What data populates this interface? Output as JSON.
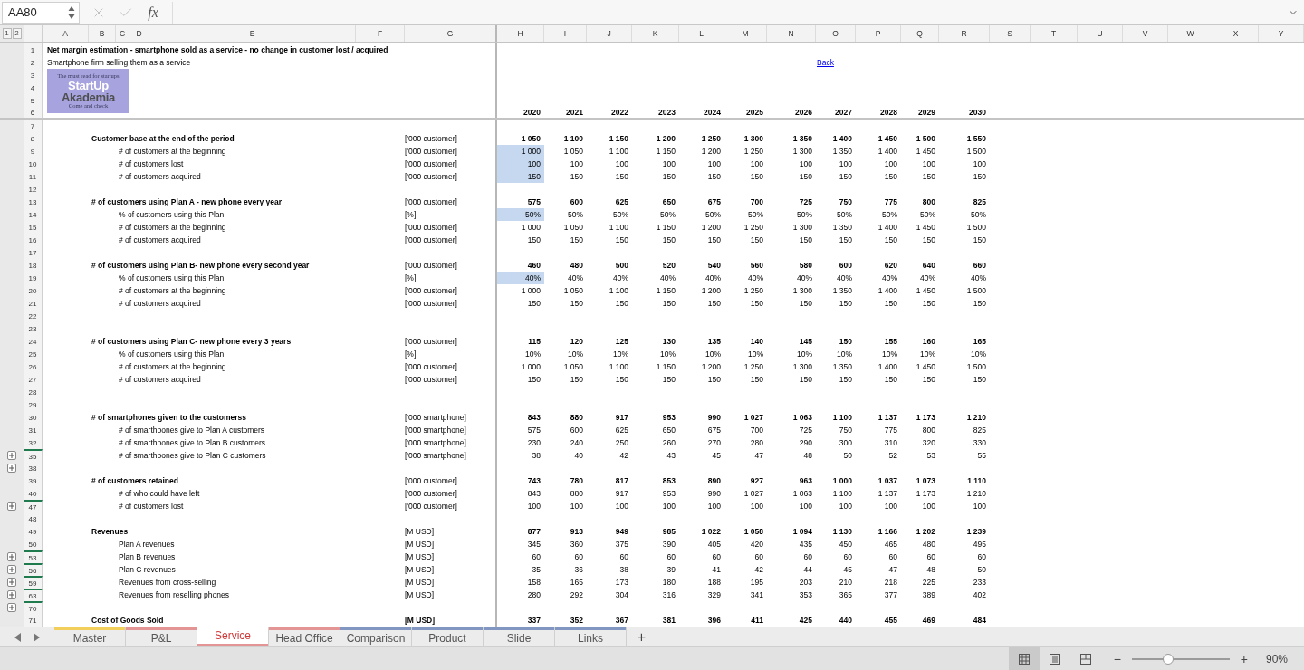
{
  "formula_bar": {
    "name_box": "AA80",
    "fx": "fx"
  },
  "outline_levels": [
    "1",
    "2"
  ],
  "columns": [
    "A",
    "B",
    "C",
    "D",
    "E",
    "F",
    "G",
    "H",
    "I",
    "J",
    "K",
    "L",
    "M",
    "N",
    "O",
    "P",
    "Q",
    "R",
    "S",
    "T",
    "U",
    "V",
    "W",
    "X",
    "Y"
  ],
  "logo": {
    "tagline": "The must read for startups",
    "line1": "StartUp",
    "line2": "Akademia",
    "footer": "Come and check"
  },
  "rows": [
    {
      "number": "1",
      "kind": "title",
      "label": "Net margin estimation - smartphone sold as a service - no change in customer lost / acquired",
      "collapsed": false,
      "hidden_above": false
    },
    {
      "number": "2",
      "kind": "subtitle",
      "label": "Smartphone firm selling them as a service",
      "link": "Back",
      "collapsed": false,
      "hidden_above": false
    },
    {
      "number": "3",
      "kind": "blank",
      "collapsed": false,
      "hidden_above": false
    },
    {
      "number": "4",
      "kind": "blank",
      "collapsed": false,
      "hidden_above": false
    },
    {
      "number": "5",
      "kind": "blank",
      "collapsed": false,
      "hidden_above": false
    },
    {
      "number": "6",
      "kind": "years",
      "values": [
        "2020",
        "2021",
        "2022",
        "2023",
        "2024",
        "2025",
        "2026",
        "2027",
        "2028",
        "2029",
        "2030"
      ],
      "highlight": false,
      "collapsed": false,
      "hidden_above": false
    },
    {
      "number": "7",
      "kind": "blank",
      "collapsed": false,
      "hidden_above": false
    },
    {
      "number": "8",
      "kind": "header",
      "label": "Customer base at the end  of the period",
      "unit": "['000 customer]",
      "values": [
        "1 050",
        "1 100",
        "1 150",
        "1 200",
        "1 250",
        "1 300",
        "1 350",
        "1 400",
        "1 450",
        "1 500",
        "1 550"
      ],
      "highlight": false,
      "collapsed": false,
      "hidden_above": false
    },
    {
      "number": "9",
      "kind": "item",
      "label": "# of customers at the beginning",
      "unit": "['000 customer]",
      "values": [
        "1 000",
        "1 050",
        "1 100",
        "1 150",
        "1 200",
        "1 250",
        "1 300",
        "1 350",
        "1 400",
        "1 450",
        "1 500"
      ],
      "highlight": true,
      "collapsed": false,
      "hidden_above": false
    },
    {
      "number": "10",
      "kind": "item",
      "label": "# of customers lost",
      "unit": "['000 customer]",
      "values": [
        "100",
        "100",
        "100",
        "100",
        "100",
        "100",
        "100",
        "100",
        "100",
        "100",
        "100"
      ],
      "highlight": true,
      "collapsed": false,
      "hidden_above": false
    },
    {
      "number": "11",
      "kind": "item",
      "label": "# of customers acquired",
      "unit": "['000 customer]",
      "values": [
        "150",
        "150",
        "150",
        "150",
        "150",
        "150",
        "150",
        "150",
        "150",
        "150",
        "150"
      ],
      "highlight": true,
      "collapsed": false,
      "hidden_above": false
    },
    {
      "number": "12",
      "kind": "blank",
      "collapsed": false,
      "hidden_above": false
    },
    {
      "number": "13",
      "kind": "header",
      "label": "# of customers using Plan A - new phone every year",
      "unit": "['000 customer]",
      "values": [
        "575",
        "600",
        "625",
        "650",
        "675",
        "700",
        "725",
        "750",
        "775",
        "800",
        "825"
      ],
      "highlight": false,
      "collapsed": false,
      "hidden_above": false
    },
    {
      "number": "14",
      "kind": "item",
      "label": "% of customers using this Plan",
      "unit": "[%]",
      "values": [
        "50%",
        "50%",
        "50%",
        "50%",
        "50%",
        "50%",
        "50%",
        "50%",
        "50%",
        "50%",
        "50%"
      ],
      "highlight": true,
      "collapsed": false,
      "hidden_above": false
    },
    {
      "number": "15",
      "kind": "item",
      "label": "# of customers at the beginning",
      "unit": "['000 customer]",
      "values": [
        "1 000",
        "1 050",
        "1 100",
        "1 150",
        "1 200",
        "1 250",
        "1 300",
        "1 350",
        "1 400",
        "1 450",
        "1 500"
      ],
      "highlight": false,
      "collapsed": false,
      "hidden_above": false
    },
    {
      "number": "16",
      "kind": "item",
      "label": "# of customers acquired",
      "unit": "['000 customer]",
      "values": [
        "150",
        "150",
        "150",
        "150",
        "150",
        "150",
        "150",
        "150",
        "150",
        "150",
        "150"
      ],
      "highlight": false,
      "collapsed": false,
      "hidden_above": false
    },
    {
      "number": "17",
      "kind": "blank",
      "collapsed": false,
      "hidden_above": false
    },
    {
      "number": "18",
      "kind": "header",
      "label": "# of customers using Plan B- new phone every second year",
      "unit": "['000 customer]",
      "values": [
        "460",
        "480",
        "500",
        "520",
        "540",
        "560",
        "580",
        "600",
        "620",
        "640",
        "660"
      ],
      "highlight": false,
      "collapsed": false,
      "hidden_above": false
    },
    {
      "number": "19",
      "kind": "item",
      "label": "% of customers using this Plan",
      "unit": "[%]",
      "values": [
        "40%",
        "40%",
        "40%",
        "40%",
        "40%",
        "40%",
        "40%",
        "40%",
        "40%",
        "40%",
        "40%"
      ],
      "highlight": true,
      "collapsed": false,
      "hidden_above": false
    },
    {
      "number": "20",
      "kind": "item",
      "label": "# of customers at the beginning",
      "unit": "['000 customer]",
      "values": [
        "1 000",
        "1 050",
        "1 100",
        "1 150",
        "1 200",
        "1 250",
        "1 300",
        "1 350",
        "1 400",
        "1 450",
        "1 500"
      ],
      "highlight": false,
      "collapsed": false,
      "hidden_above": false
    },
    {
      "number": "21",
      "kind": "item",
      "label": "# of customers acquired",
      "unit": "['000 customer]",
      "values": [
        "150",
        "150",
        "150",
        "150",
        "150",
        "150",
        "150",
        "150",
        "150",
        "150",
        "150"
      ],
      "highlight": false,
      "collapsed": false,
      "hidden_above": false
    },
    {
      "number": "22",
      "kind": "blank",
      "collapsed": false,
      "hidden_above": false
    },
    {
      "number": "23",
      "kind": "blank",
      "collapsed": false,
      "hidden_above": false
    },
    {
      "number": "24",
      "kind": "header",
      "label": "# of customers using Plan C- new phone every 3 years",
      "unit": "['000 customer]",
      "values": [
        "115",
        "120",
        "125",
        "130",
        "135",
        "140",
        "145",
        "150",
        "155",
        "160",
        "165"
      ],
      "highlight": false,
      "collapsed": false,
      "hidden_above": false
    },
    {
      "number": "25",
      "kind": "item",
      "label": "% of customers using this Plan",
      "unit": "[%]",
      "values": [
        "10%",
        "10%",
        "10%",
        "10%",
        "10%",
        "10%",
        "10%",
        "10%",
        "10%",
        "10%",
        "10%"
      ],
      "highlight": false,
      "collapsed": false,
      "hidden_above": false
    },
    {
      "number": "26",
      "kind": "item",
      "label": "# of customers at the beginning",
      "unit": "['000 customer]",
      "values": [
        "1 000",
        "1 050",
        "1 100",
        "1 150",
        "1 200",
        "1 250",
        "1 300",
        "1 350",
        "1 400",
        "1 450",
        "1 500"
      ],
      "highlight": false,
      "collapsed": false,
      "hidden_above": false
    },
    {
      "number": "27",
      "kind": "item",
      "label": "# of customers acquired",
      "unit": "['000 customer]",
      "values": [
        "150",
        "150",
        "150",
        "150",
        "150",
        "150",
        "150",
        "150",
        "150",
        "150",
        "150"
      ],
      "highlight": false,
      "collapsed": false,
      "hidden_above": false
    },
    {
      "number": "28",
      "kind": "blank",
      "collapsed": false,
      "hidden_above": false
    },
    {
      "number": "29",
      "kind": "blank",
      "collapsed": false,
      "hidden_above": false
    },
    {
      "number": "30",
      "kind": "header",
      "label": "# of smartphones given to the customerss",
      "unit": "['000 smartphone]",
      "values": [
        "843",
        "880",
        "917",
        "953",
        "990",
        "1 027",
        "1 063",
        "1 100",
        "1 137",
        "1 173",
        "1 210"
      ],
      "highlight": false,
      "collapsed": false,
      "hidden_above": false
    },
    {
      "number": "31",
      "kind": "item",
      "label": "# of smarthpones give to Plan A customers",
      "unit": "['000 smartphone]",
      "values": [
        "575",
        "600",
        "625",
        "650",
        "675",
        "700",
        "725",
        "750",
        "775",
        "800",
        "825"
      ],
      "highlight": false,
      "collapsed": false,
      "hidden_above": false
    },
    {
      "number": "32",
      "kind": "item",
      "label": "# of smarthpones give to Plan B customers",
      "unit": "['000 smartphone]",
      "values": [
        "230",
        "240",
        "250",
        "260",
        "270",
        "280",
        "290",
        "300",
        "310",
        "320",
        "330"
      ],
      "highlight": false,
      "collapsed": false,
      "hidden_above": false
    },
    {
      "number": "35",
      "kind": "item",
      "label": "# of smarthpones give to Plan C customers",
      "unit": "['000 smartphone]",
      "values": [
        "38",
        "40",
        "42",
        "43",
        "45",
        "47",
        "48",
        "50",
        "52",
        "53",
        "55"
      ],
      "highlight": false,
      "collapsed": true,
      "hidden_above": true
    },
    {
      "number": "38",
      "kind": "blank",
      "collapsed": true,
      "hidden_above": false
    },
    {
      "number": "39",
      "kind": "header",
      "label": "# of customers retained",
      "unit": "['000 customer]",
      "values": [
        "743",
        "780",
        "817",
        "853",
        "890",
        "927",
        "963",
        "1 000",
        "1 037",
        "1 073",
        "1 110"
      ],
      "highlight": false,
      "collapsed": false,
      "hidden_above": false
    },
    {
      "number": "40",
      "kind": "item",
      "label": "# of who could have left",
      "unit": "['000 customer]",
      "values": [
        "843",
        "880",
        "917",
        "953",
        "990",
        "1 027",
        "1 063",
        "1 100",
        "1 137",
        "1 173",
        "1 210"
      ],
      "highlight": false,
      "collapsed": false,
      "hidden_above": false
    },
    {
      "number": "47",
      "kind": "item",
      "label": "# of customers lost",
      "unit": "['000 customer]",
      "values": [
        "100",
        "100",
        "100",
        "100",
        "100",
        "100",
        "100",
        "100",
        "100",
        "100",
        "100"
      ],
      "highlight": false,
      "collapsed": true,
      "hidden_above": true
    },
    {
      "number": "48",
      "kind": "blank",
      "collapsed": false,
      "hidden_above": false
    },
    {
      "number": "49",
      "kind": "header",
      "label": "Revenues",
      "unit": "[M USD]",
      "values": [
        "877",
        "913",
        "949",
        "985",
        "1 022",
        "1 058",
        "1 094",
        "1 130",
        "1 166",
        "1 202",
        "1 239"
      ],
      "highlight": false,
      "collapsed": false,
      "hidden_above": false
    },
    {
      "number": "50",
      "kind": "item",
      "label": "Plan A revenues",
      "unit": "[M USD]",
      "values": [
        "345",
        "360",
        "375",
        "390",
        "405",
        "420",
        "435",
        "450",
        "465",
        "480",
        "495"
      ],
      "highlight": false,
      "collapsed": false,
      "hidden_above": false
    },
    {
      "number": "53",
      "kind": "item",
      "label": "Plan B revenues",
      "unit": "[M USD]",
      "values": [
        "60",
        "60",
        "60",
        "60",
        "60",
        "60",
        "60",
        "60",
        "60",
        "60",
        "60"
      ],
      "highlight": false,
      "collapsed": true,
      "hidden_above": true
    },
    {
      "number": "56",
      "kind": "item",
      "label": "Plan C revenues",
      "unit": "[M USD]",
      "values": [
        "35",
        "36",
        "38",
        "39",
        "41",
        "42",
        "44",
        "45",
        "47",
        "48",
        "50"
      ],
      "highlight": false,
      "collapsed": true,
      "hidden_above": true
    },
    {
      "number": "59",
      "kind": "item",
      "label": "Revenues from cross-selling",
      "unit": "[M USD]",
      "values": [
        "158",
        "165",
        "173",
        "180",
        "188",
        "195",
        "203",
        "210",
        "218",
        "225",
        "233"
      ],
      "highlight": false,
      "collapsed": true,
      "hidden_above": true
    },
    {
      "number": "63",
      "kind": "item",
      "label": "Revenues from reselling phones",
      "unit": "[M USD]",
      "values": [
        "280",
        "292",
        "304",
        "316",
        "329",
        "341",
        "353",
        "365",
        "377",
        "389",
        "402"
      ],
      "highlight": false,
      "collapsed": true,
      "hidden_above": true
    },
    {
      "number": "70",
      "kind": "blank",
      "collapsed": true,
      "hidden_above": true
    },
    {
      "number": "71",
      "kind": "total",
      "label": "Cost of Goods Sold",
      "unit": "[M USD]",
      "values": [
        "337",
        "352",
        "367",
        "381",
        "396",
        "411",
        "425",
        "440",
        "455",
        "469",
        "484"
      ],
      "highlight": false,
      "collapsed": false,
      "hidden_above": false
    }
  ],
  "sheet_tabs": [
    {
      "label": "Master",
      "color": "#f2cf5b",
      "selected": false
    },
    {
      "label": "P&L",
      "color": "#e39595",
      "selected": false
    },
    {
      "label": "Service",
      "color": "#e39595",
      "selected": true
    },
    {
      "label": "Head Office",
      "color": "#e39595",
      "selected": false
    },
    {
      "label": "Comparison",
      "color": "#8197c2",
      "selected": false
    },
    {
      "label": "Product",
      "color": "#8197c2",
      "selected": false
    },
    {
      "label": "Slide",
      "color": "#8197c2",
      "selected": false
    },
    {
      "label": "Links",
      "color": "#8197c2",
      "selected": false
    }
  ],
  "add_sheet": "+",
  "status_bar": {
    "views": [
      {
        "kind": "normal",
        "selected": true
      },
      {
        "kind": "page_layout",
        "selected": false
      },
      {
        "kind": "page_break",
        "selected": false
      }
    ],
    "zoom": {
      "minus": "−",
      "plus": "+",
      "level": 0.37,
      "reading": "90%"
    }
  }
}
